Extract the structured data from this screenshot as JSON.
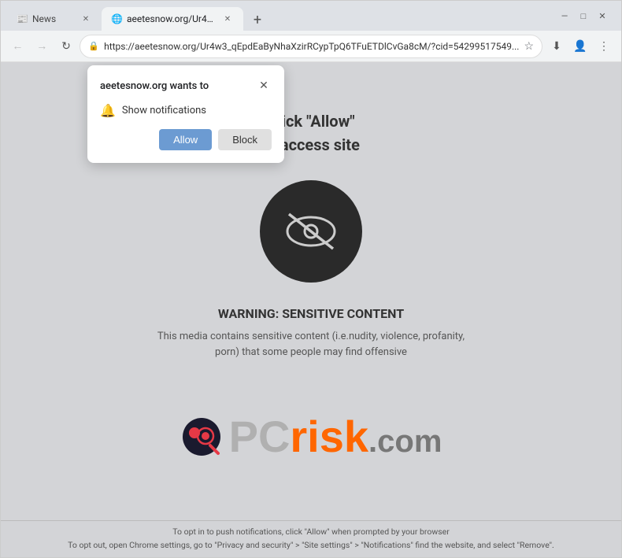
{
  "browser": {
    "tabs": [
      {
        "id": "tab-news",
        "label": "News",
        "favicon": "📰",
        "active": false,
        "closeable": true
      },
      {
        "id": "tab-aeetesnow",
        "label": "aeetesnow.org/Ur4w3_qEpdEa...",
        "favicon": "🌐",
        "active": true,
        "closeable": true
      }
    ],
    "new_tab_label": "+",
    "window_controls": {
      "minimize": "—",
      "maximize": "□",
      "close": "✕"
    },
    "nav": {
      "back": "←",
      "forward": "→",
      "refresh": "↻",
      "address": "https://aeetesnow.org/Ur4w3_qEpdEaByNhaXzirRCypTpQ6TFuETDlCvGa8cM/?cid=54299517549...",
      "address_short": "https://aeetesnow.org/Ur4w3_qEpdEaByNhaXzirRCypTpQ6TFuETDlCvGa8cM/?cid=54299517549...",
      "star": "☆",
      "download": "⬇",
      "profile": "👤",
      "menu": "⋮"
    }
  },
  "notification_popup": {
    "title": "aeetesnow.org wants to",
    "close_btn": "✕",
    "notification_item": "Show notifications",
    "allow_btn": "Allow",
    "block_btn": "Block"
  },
  "page": {
    "click_allow_line1": "Click \"Allow\"",
    "click_allow_line2": "to access site",
    "warning_title": "WARNING: SENSITIVE CONTENT",
    "warning_text": "This media contains sensitive content (i.e.nudity, violence, profanity, porn) that some people may find offensive"
  },
  "footer": {
    "line1": "To opt in to push notifications, click \"Allow\" when prompted by your browser",
    "line2": "To opt out, open Chrome settings, go to \"Privacy and security\" > \"Site settings\" > \"Notifications\" find the website, and select \"Remove\"."
  },
  "pcrisk": {
    "text_pc": "PC",
    "text_risk": "risk",
    "text_dotcom": ".com"
  }
}
